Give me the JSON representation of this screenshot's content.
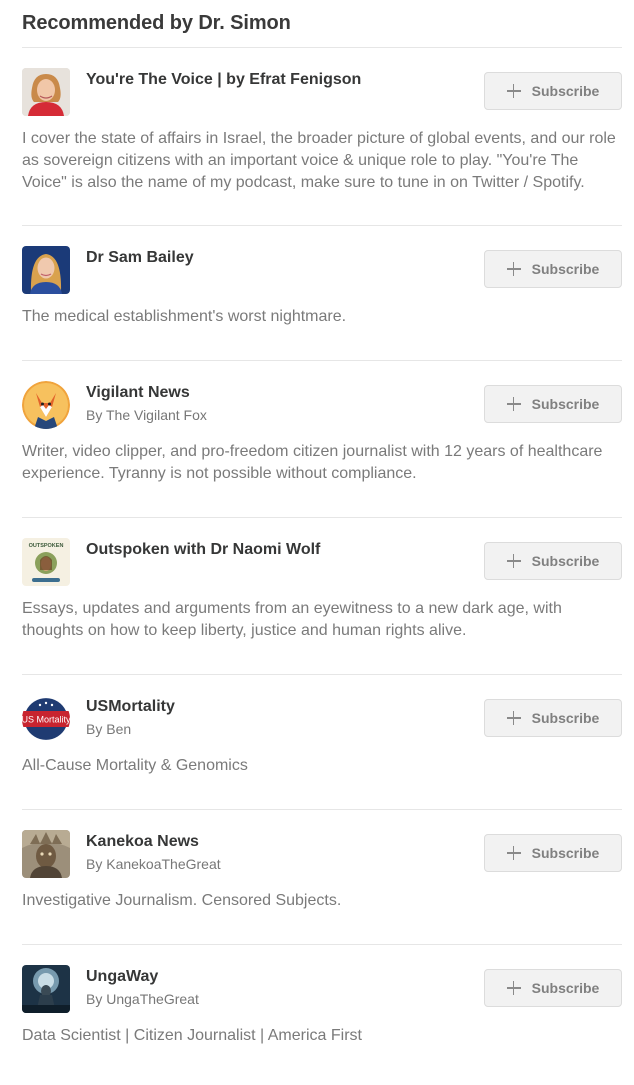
{
  "section": {
    "title": "Recommended by Dr. Simon"
  },
  "recommendations": [
    {
      "title": "You're The Voice | by Efrat Fenigson",
      "byline": "",
      "description": "I cover the state of affairs in Israel, the broader picture of global events, and our role as sovereign citizens with an important voice & unique role to play. \"You're The Voice\" is also the name of my podcast, make sure to tune in on Twitter / Spotify.",
      "subscribe_label": "Subscribe"
    },
    {
      "title": "Dr Sam Bailey",
      "byline": "",
      "description": "The medical establishment's worst nightmare.",
      "subscribe_label": "Subscribe"
    },
    {
      "title": "Vigilant News",
      "byline": "By The Vigilant Fox",
      "description": "Writer, video clipper, and pro-freedom citizen journalist with 12 years of healthcare experience. Tyranny is not possible without compliance.",
      "subscribe_label": "Subscribe"
    },
    {
      "title": "Outspoken with Dr Naomi Wolf",
      "byline": "",
      "description": "Essays, updates and arguments from an eyewitness to a new dark age, with thoughts on how to keep liberty, justice and human rights alive.",
      "subscribe_label": "Subscribe",
      "avatar_text": "OUTSPOKEN"
    },
    {
      "title": "USMortality",
      "byline": "By Ben",
      "description": "All-Cause Mortality & Genomics",
      "subscribe_label": "Subscribe",
      "avatar_text": "US Mortality"
    },
    {
      "title": "Kanekoa News",
      "byline": "By KanekoaTheGreat",
      "description": "Investigative Journalism. Censored Subjects.",
      "subscribe_label": "Subscribe"
    },
    {
      "title": "UngaWay",
      "byline": "By UngaTheGreat",
      "description": "Data Scientist | Citizen Journalist | America First",
      "subscribe_label": "Subscribe"
    }
  ],
  "colors": {
    "button_bg": "#f2f2f2",
    "button_text": "#808080",
    "title_text": "#363737",
    "desc_text": "#7a7a7a",
    "divider": "#e6e6e6"
  }
}
